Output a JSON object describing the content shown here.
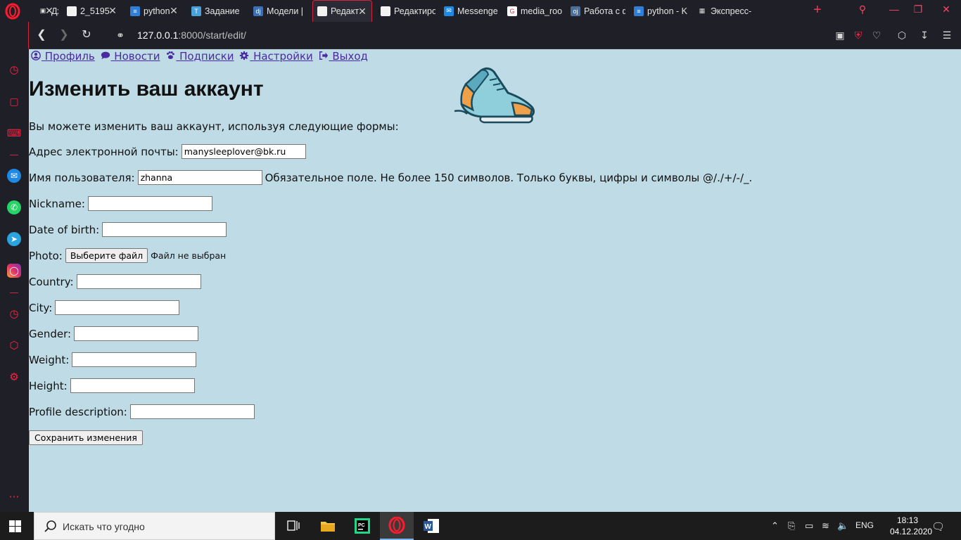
{
  "browser": {
    "tabs": [
      {
        "title": "Джерв",
        "icon": "gamepad-icon",
        "closable": true
      },
      {
        "title": "2_5195",
        "icon": "document-icon",
        "closable": true
      },
      {
        "title": "python",
        "icon": "stackoverflow-icon",
        "closable": true
      },
      {
        "title": "Задание",
        "icon": "tinkoff-icon",
        "closable": false
      },
      {
        "title": "Модели |",
        "icon": "django-icon",
        "closable": false
      },
      {
        "title": "Редакт",
        "icon": "document-icon",
        "closable": true,
        "active": true
      },
      {
        "title": "Редактиро",
        "icon": "document-icon",
        "closable": false
      },
      {
        "title": "Messenge",
        "icon": "messenger-icon",
        "closable": false
      },
      {
        "title": "media_roo",
        "icon": "google-icon",
        "closable": false
      },
      {
        "title": "Работа с ф",
        "icon": "site-icon",
        "closable": false
      },
      {
        "title": "python - K",
        "icon": "stackoverflow-icon",
        "closable": false
      },
      {
        "title": "Экспресс-",
        "icon": "grid-icon",
        "closable": false
      }
    ],
    "url_host": "127.0.0.1",
    "url_rest": ":8000/start/edit/"
  },
  "nav": {
    "profile": " Профиль",
    "news": " Новости",
    "subscriptions": " Подписки",
    "settings": " Настройки",
    "logout": " Выход"
  },
  "page": {
    "title": "Изменить ваш аккаунт",
    "intro": "Вы можете изменить ваш аккаунт, используя следующие формы:"
  },
  "form": {
    "email_label": "Адрес электронной почты:",
    "email_value": "manysleeplover@bk.ru",
    "username_label": "Имя пользователя:",
    "username_value": "zhanna",
    "username_help": "Обязательное поле. Не более 150 символов. Только буквы, цифры и символы @/./+/-/_.",
    "nickname_label": "Nickname:",
    "birth_label": "Date of birth:",
    "photo_label": "Photo:",
    "file_button": "Выберите файл",
    "file_status": "Файл не выбран",
    "country_label": "Country:",
    "city_label": "City:",
    "gender_label": "Gender:",
    "weight_label": "Weight:",
    "height_label": "Height:",
    "description_label": "Profile description:",
    "submit": "Сохранить изменения"
  },
  "taskbar": {
    "search_placeholder": "Искать что угодно",
    "lang": "ENG",
    "time": "18:13",
    "date": "04.12.2020"
  },
  "colors": {
    "page_bg": "#bfdbe6",
    "accent": "#d0243f",
    "link": "#4a2aa0"
  }
}
